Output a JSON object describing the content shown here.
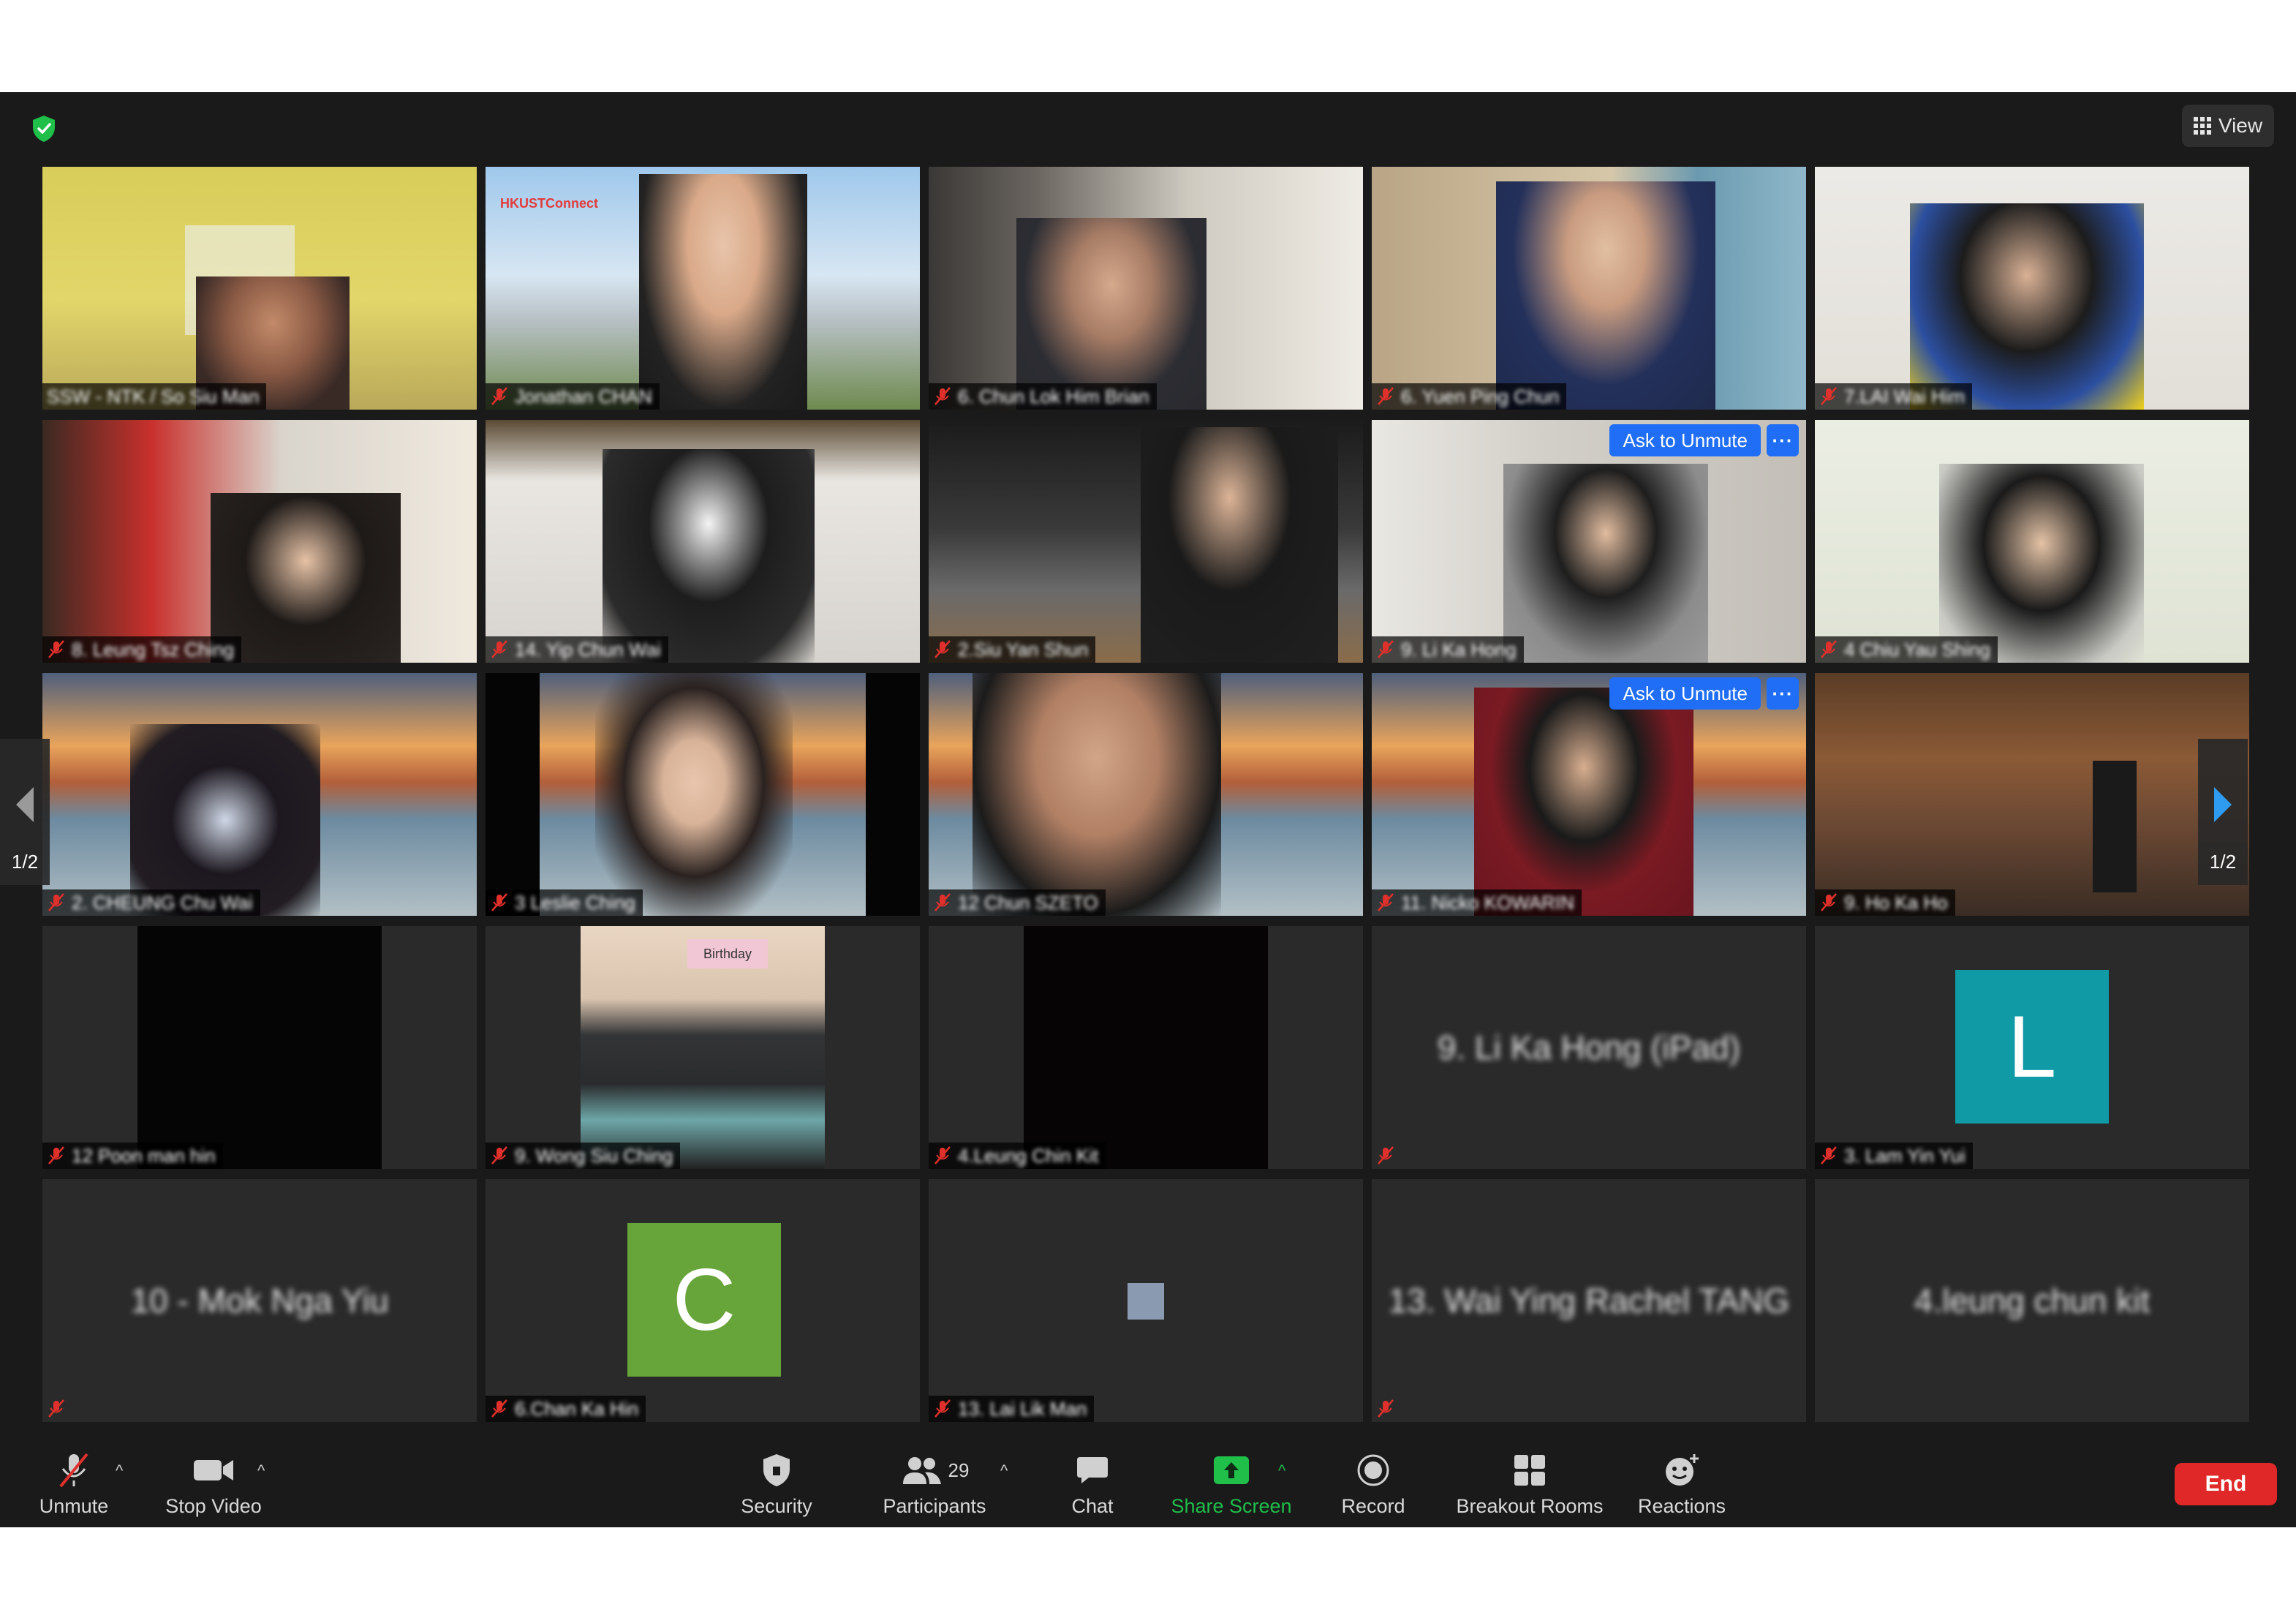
{
  "window": {
    "view_label": "View"
  },
  "pager": {
    "left": "1/2",
    "right": "1/2"
  },
  "tiles": {
    "t0": {
      "name": "SSW - NTK / So Siu Man"
    },
    "t1": {
      "name": "Jonathan CHAN",
      "logo": "HKUSTConnect"
    },
    "t2": {
      "name": "6. Chun Lok Him Brian"
    },
    "t3": {
      "name": "6. Yuen Ping Chun"
    },
    "t4": {
      "name": "7.LAI Wai Him"
    },
    "t5": {
      "name": "8. Leung Tsz Ching"
    },
    "t6": {
      "name": "14. Yip Chun Wai"
    },
    "t7": {
      "name": "2.Siu Yan Shun"
    },
    "t8": {
      "name": "9. Li Ka Hong",
      "ask": "Ask to Unmute",
      "more": "···"
    },
    "t9": {
      "name": "4 Chiu Yau Shing"
    },
    "t10": {
      "name": "2. CHEUNG Chu Wai"
    },
    "t11": {
      "name": "3 Leslie Ching"
    },
    "t12": {
      "name": "12 Chun SZETO"
    },
    "t13": {
      "name": "11. Nicko KOWARIN",
      "ask": "Ask to Unmute",
      "more": "···"
    },
    "t14": {
      "name": "9. Ho Ka Ho"
    },
    "t15": {
      "name": "12 Poon man hin"
    },
    "t16": {
      "name": "9. Wong Siu Ching",
      "sign": "Birthday"
    },
    "t17": {
      "name": "4.Leung Chin Kit"
    },
    "t18": {
      "center": "9. Li Ka Hong (iPad)"
    },
    "t19": {
      "name": "3. Lam Yin Yui",
      "initial": "L"
    },
    "t20": {
      "center": "10 - Mok Nga Yiu"
    },
    "t21": {
      "name": "6.Chan Ka Hin",
      "initial": "C"
    },
    "t22": {
      "name": "13. Lai Lik Man"
    },
    "t23": {
      "center": "13. Wai Ying Rachel TANG"
    },
    "t24": {
      "center": "4.leung chun kit"
    }
  },
  "toolbar": {
    "unmute": "Unmute",
    "stop_video": "Stop Video",
    "security": "Security",
    "participants": "Participants",
    "participants_count": "29",
    "chat": "Chat",
    "share_screen": "Share Screen",
    "record": "Record",
    "breakout_rooms": "Breakout Rooms",
    "reactions": "Reactions",
    "end": "End"
  },
  "colors": {
    "accent_blue": "#1f6ef5",
    "share_green": "#1fbf4a",
    "end_red": "#e02828",
    "mute_red": "#e0302b",
    "speaker_outline": "#d9e37a",
    "avatar_teal": "#0f9aa6",
    "avatar_green": "#67a53b"
  },
  "icons": [
    "shield-check-icon",
    "grid-view-icon",
    "mic-muted-icon",
    "video-camera-icon",
    "security-shield-icon",
    "participants-icon",
    "chat-bubble-icon",
    "share-screen-icon",
    "record-icon",
    "breakout-rooms-icon",
    "reactions-icon",
    "chevron-left-icon",
    "chevron-right-icon",
    "caret-up-icon"
  ]
}
